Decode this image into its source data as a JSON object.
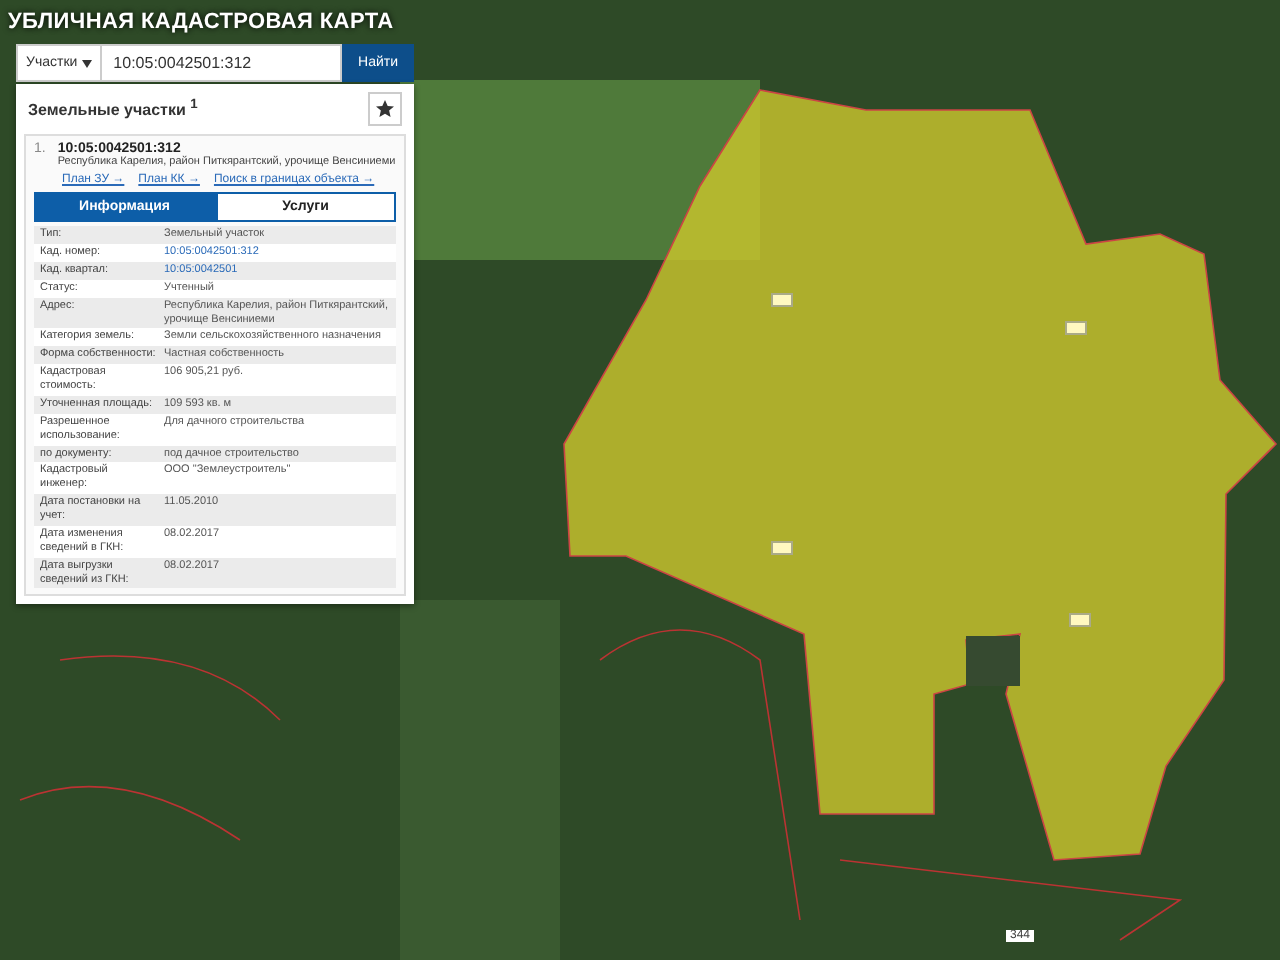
{
  "header": {
    "title": "УБЛИЧНАЯ КАДАСТРОВАЯ КАРТА"
  },
  "search": {
    "type_select": "Участки",
    "value": "10:05:0042501:312",
    "button": "Найти"
  },
  "section": {
    "title": "Земельные участки",
    "count": "1"
  },
  "result": {
    "index": "1.",
    "number": "10:05:0042501:312",
    "address": "Республика Карелия, район Питкярантский, урочище Венсиниеми",
    "links": [
      "План ЗУ →",
      "План КК →",
      "Поиск в границах объекта →"
    ]
  },
  "tabs": [
    {
      "label": "Информация",
      "selected": true
    },
    {
      "label": "Услуги",
      "selected": false
    }
  ],
  "rows": [
    {
      "label": "Тип:",
      "value": "Земельный участок",
      "kind": "text"
    },
    {
      "label": "Кад. номер:",
      "value": "10:05:0042501:312",
      "kind": "link"
    },
    {
      "label": "Кад. квартал:",
      "value": "10:05:0042501",
      "kind": "link"
    },
    {
      "label": "Статус:",
      "value": "Учтенный",
      "kind": "text"
    },
    {
      "label": "Адрес:",
      "value": "Республика Карелия, район Питкярантский, урочище Венсиниеми",
      "kind": "text"
    },
    {
      "label": "Категория земель:",
      "value": "Земли сельскохозяйственного назначения",
      "kind": "text"
    },
    {
      "label": "Форма собственности:",
      "value": "Частная собственность",
      "kind": "text"
    },
    {
      "label": "Кадастровая стоимость:",
      "value": "106 905,21 руб.",
      "kind": "text"
    },
    {
      "label": "Уточненная площадь:",
      "value": "109 593 кв. м",
      "kind": "text"
    },
    {
      "label": "Разрешенное использование:",
      "value": "Для дачного строительства",
      "kind": "text"
    },
    {
      "label": "по документу:",
      "value": "под дачное строительство",
      "kind": "text"
    },
    {
      "label": "Кадастровый инженер:",
      "value": "ООО \"Землеустроитель\"",
      "kind": "text"
    },
    {
      "label": "Дата постановки на учет:",
      "value": "11.05.2010",
      "kind": "text"
    },
    {
      "label": "Дата изменения сведений в ГКН:",
      "value": "08.02.2017",
      "kind": "text"
    },
    {
      "label": "Дата выгрузки сведений из ГКН:",
      "value": "08.02.2017",
      "kind": "text"
    }
  ],
  "map_labels": [
    "344"
  ]
}
